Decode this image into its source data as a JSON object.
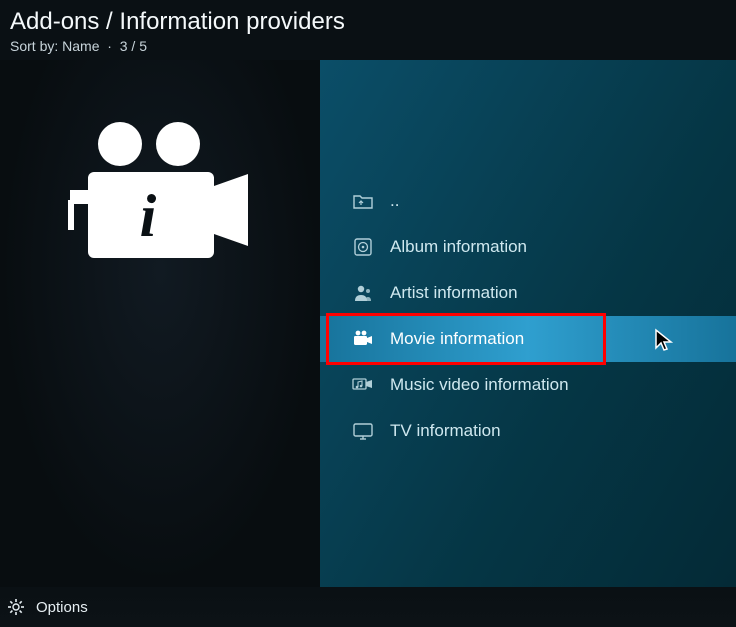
{
  "header": {
    "title": "Add-ons / Information providers",
    "sort_label": "Sort by:",
    "sort_value": "Name",
    "position": "3 / 5"
  },
  "items": [
    {
      "label": "..",
      "icon": "folder-up",
      "selected": false
    },
    {
      "label": "Album information",
      "icon": "album",
      "selected": false
    },
    {
      "label": "Artist information",
      "icon": "artist",
      "selected": false
    },
    {
      "label": "Movie information",
      "icon": "movie",
      "selected": true
    },
    {
      "label": "Music video information",
      "icon": "music-video",
      "selected": false
    },
    {
      "label": "TV information",
      "icon": "tv",
      "selected": false
    }
  ],
  "footer": {
    "options_label": "Options"
  }
}
